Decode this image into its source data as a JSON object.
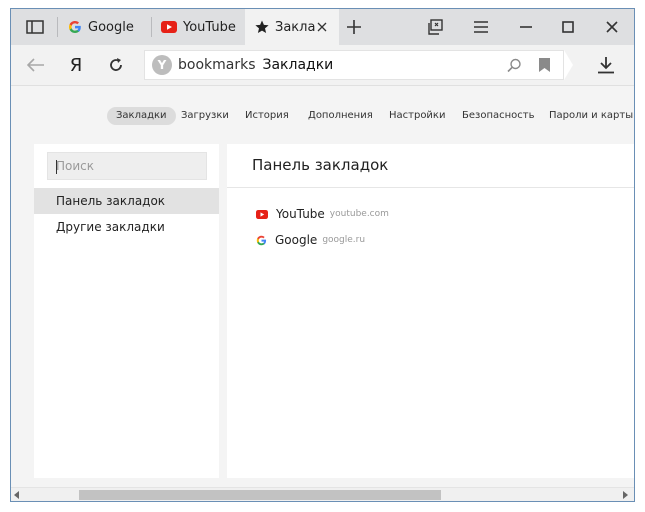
{
  "tabs": [
    {
      "label": "Google",
      "icon": "google-icon"
    },
    {
      "label": "YouTube",
      "icon": "youtube-icon"
    },
    {
      "label": "Закладк",
      "icon": "star-icon",
      "active": true
    }
  ],
  "toolbar": {
    "yandex_logo": "Я",
    "address_prefix": "bookmarks",
    "address_title": "Закладки"
  },
  "nav": {
    "items": [
      {
        "label": "Закладки",
        "active": true
      },
      {
        "label": "Загрузки"
      },
      {
        "label": "История"
      },
      {
        "label": "Дополнения"
      },
      {
        "label": "Настройки"
      },
      {
        "label": "Безопасность"
      },
      {
        "label": "Пароли и карты"
      }
    ]
  },
  "sidebar": {
    "search_placeholder": "Поиск",
    "items": [
      {
        "label": "Панель закладок",
        "active": true
      },
      {
        "label": "Другие закладки"
      }
    ]
  },
  "main": {
    "title": "Панель закладок",
    "bookmarks": [
      {
        "name": "YouTube",
        "url": "youtube.com",
        "icon": "youtube-icon"
      },
      {
        "name": "Google",
        "url": "google.ru",
        "icon": "google-icon"
      }
    ]
  },
  "colors": {
    "youtube_red": "#e62117",
    "google_blue": "#4285f4",
    "tab_bar": "#dedfe1"
  }
}
